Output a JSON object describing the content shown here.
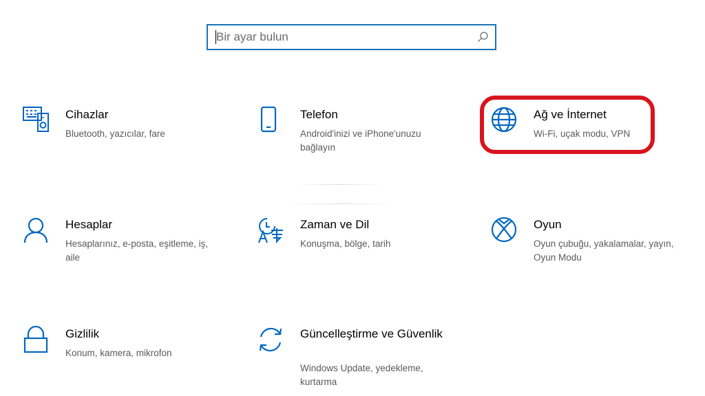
{
  "search": {
    "placeholder": "Bir ayar bulun"
  },
  "tiles": [
    {
      "title": "Cihazlar",
      "desc": "Bluetooth, yazıcılar, fare",
      "icon": "devices-icon"
    },
    {
      "title": "Telefon",
      "desc": "Android'inizi ve iPhone'unuzu bağlayın",
      "icon": "phone-icon"
    },
    {
      "title": "Ağ ve İnternet",
      "desc": "Wi-Fi, uçak modu, VPN",
      "icon": "globe-icon"
    },
    {
      "title": "Hesaplar",
      "desc": "Hesaplarınız, e-posta, eşitleme, iş, aile",
      "icon": "person-icon"
    },
    {
      "title": "Zaman ve Dil",
      "desc": "Konuşma, bölge, tarih",
      "icon": "time-language-icon"
    },
    {
      "title": "Oyun",
      "desc": "Oyun çubuğu, yakalamalar, yayın, Oyun Modu",
      "icon": "xbox-icon"
    },
    {
      "title": "Gizlilik",
      "desc": "Konum, kamera, mikrofon",
      "icon": "lock-icon"
    },
    {
      "title": "Güncelleştirme ve Güvenlik",
      "desc": "Windows Update, yedekleme, kurtarma",
      "icon": "update-icon"
    }
  ],
  "colors": {
    "accent": "#0067c0",
    "highlight": "#d8141e",
    "title": "#000000",
    "desc": "#5a5a5a"
  }
}
